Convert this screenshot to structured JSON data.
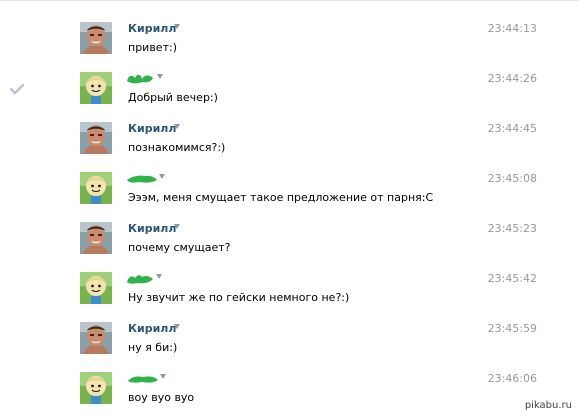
{
  "messages": [
    {
      "sender": "Кирилл",
      "type": "kirill",
      "time": "23:44:13",
      "text": "привет:)",
      "read_mark": false
    },
    {
      "sender": "",
      "type": "girl",
      "time": "23:44:26",
      "text": "Добрый вечер:)",
      "read_mark": true
    },
    {
      "sender": "Кирилл",
      "type": "kirill",
      "time": "23:44:45",
      "text": "познакомимся?:)",
      "read_mark": false
    },
    {
      "sender": "",
      "type": "girl",
      "time": "23:45:08",
      "text": "Эээм, меня смущает такое предложение от парня:С",
      "read_mark": false
    },
    {
      "sender": "Кирилл",
      "type": "kirill",
      "time": "23:45:23",
      "text": "почему смущает?",
      "read_mark": false
    },
    {
      "sender": "",
      "type": "girl",
      "time": "23:45:42",
      "text": "Ну звучит же по гейски немного не?:)",
      "read_mark": false
    },
    {
      "sender": "Кирилл",
      "type": "kirill",
      "time": "23:45:59",
      "text": "ну я би:)",
      "read_mark": false
    },
    {
      "sender": "",
      "type": "girl",
      "time": "23:46:06",
      "text": "воу вуо вуо",
      "read_mark": false
    }
  ],
  "colors": {
    "author": "#2b587a",
    "time": "#999999",
    "censor": "#2fb34a",
    "check": "#b8c6d3"
  },
  "icons": {
    "read_mark": "checkmark-icon",
    "dropdown": "triangle-down-icon"
  },
  "watermark": "pikabu.ru"
}
